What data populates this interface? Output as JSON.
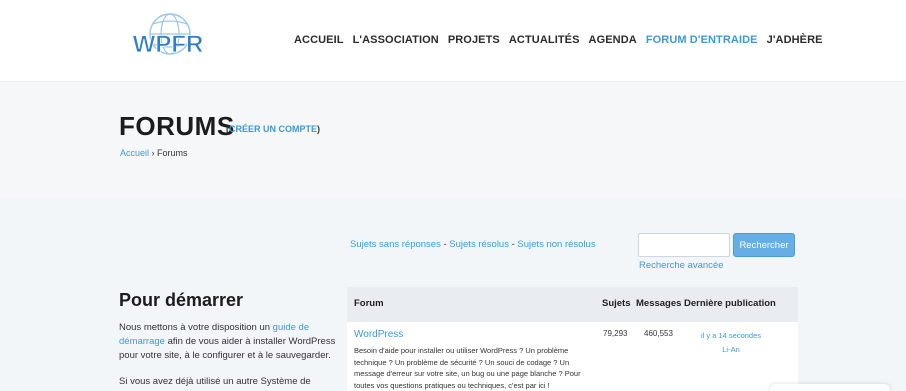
{
  "header": {
    "logo_text": "WPFR",
    "brand_color": "#3a9ad9",
    "nav": [
      {
        "label": "ACCUEIL",
        "active": false
      },
      {
        "label": "L'ASSOCIATION",
        "active": false
      },
      {
        "label": "PROJETS",
        "active": false
      },
      {
        "label": "ACTUALITÉS",
        "active": false
      },
      {
        "label": "AGENDA",
        "active": false
      },
      {
        "label": "FORUM D'ENTRAIDE",
        "active": true
      },
      {
        "label": "J'ADHÈRE",
        "active": false
      }
    ]
  },
  "hero": {
    "title": "FORUMS",
    "create_open": "(",
    "create_link": "CRÉER UN COMPTE",
    "create_close": ")",
    "breadcrumb_home": "Accueil",
    "breadcrumb_sep": " › ",
    "breadcrumb_current": "Forums"
  },
  "topics": {
    "unanswered": "Sujets sans réponses",
    "resolved": "Sujets résolus",
    "unresolved": "Sujets non résolus",
    "sep": " - "
  },
  "search": {
    "input_value": "",
    "button_label": "Rechercher",
    "advanced": "Recherche avancée"
  },
  "sidebar": {
    "title": "Pour démarrer",
    "p1_before": "Nous mettons à votre disposition un ",
    "p1_link": "guide de démarrage",
    "p1_after": " afin de vous aider à installer WordPress pour votre site, à le configurer et à le sauvegarder.",
    "p2": "Si vous avez déjà utilisé un autre Système de"
  },
  "forum_table": {
    "headers": {
      "forum": "Forum",
      "topics": "Sujets",
      "messages": "Messages",
      "last_post": "Dernière publication"
    },
    "rows": [
      {
        "name": "WordPress",
        "description": "Besoin d'aide pour installer ou utiliser WordPress ? Un problème technique ? Un problème de sécurité ? Un souci de codage ? Un message d'erreur sur votre site, un bug ou une page blanche ? Pour toutes vos questions pratiques ou techniques, c'est par ici !",
        "topics": "79,293",
        "messages": "460,553",
        "last_post_time": "il y a 14 secondes",
        "last_post_author": "Li-An"
      }
    ]
  }
}
